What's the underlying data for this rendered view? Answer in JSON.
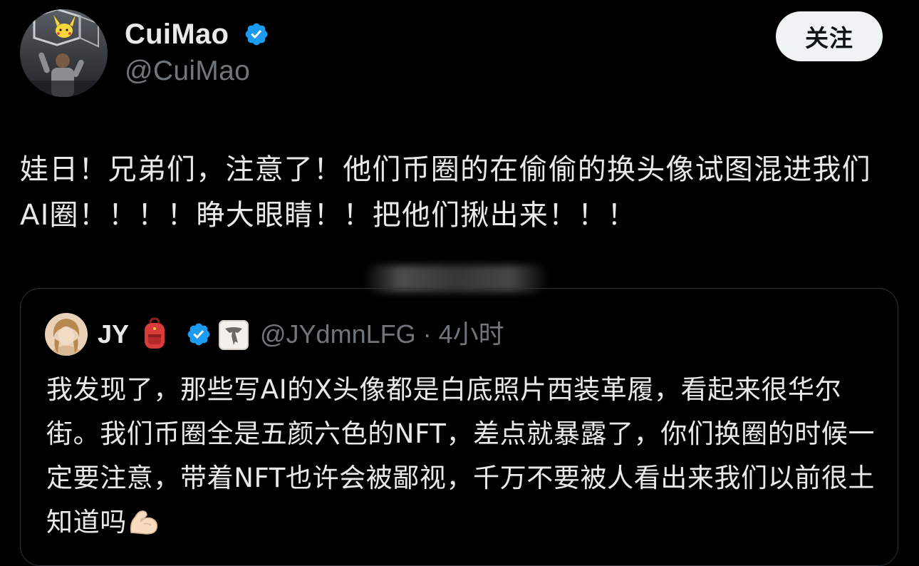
{
  "author": {
    "display_name": "CuiMao",
    "handle": "@CuiMao",
    "verified_icon": "verified-badge-icon"
  },
  "follow_button": {
    "label": "关注"
  },
  "tweet": {
    "text": "娃日！兄弟们，注意了！他们币圈的在偷偷的换头像试图混进我们AI圈！！！！睁大眼睛！！把他们揪出来！！！"
  },
  "quoted_tweet": {
    "display_name": "JY",
    "name_emoji": "backpack-icon",
    "affiliate_badge": "affiliate-badge-icon",
    "handle_time": "@JYdmnLFG · 4小时",
    "text": "我发现了，那些写AI的X头像都是白底照片西装革履，看起来很华尔街。我们币圈全是五颜六色的NFT，差点就暴露了，你们换圈的时候一定要注意，带着NFT也许会被鄙视，千万不要被人看出来我们以前很土知道吗",
    "trailing_emoji": "flexed-biceps-icon"
  },
  "colors": {
    "background": "#000000",
    "primary_text": "#e7e9ea",
    "secondary_text": "#71767b",
    "verified_blue": "#1d9bf0",
    "card_border": "#2f3336",
    "button_bg": "#eff3f4"
  }
}
